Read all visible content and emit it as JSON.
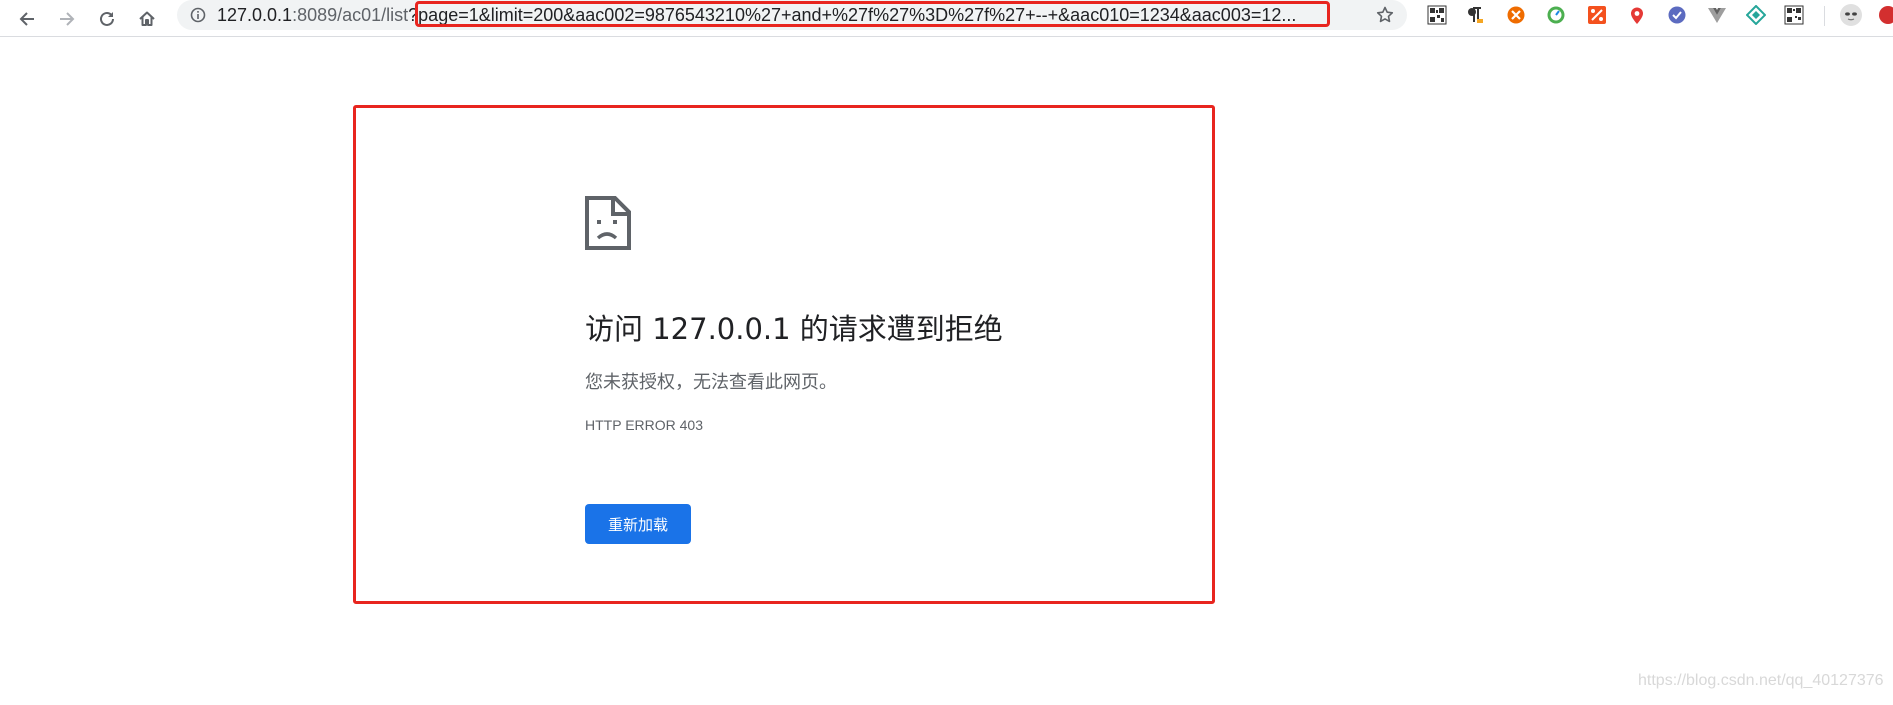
{
  "browser": {
    "url": {
      "host": "127.0.0.1",
      "path": ":8089/ac01/list",
      "query": "?page=1&limit=200&aac002=9876543210%27+and+%27f%27%3D%27f%27+--+&aac010=1234&aac003=12..."
    }
  },
  "icons": {
    "back": "back-arrow-icon",
    "forward": "forward-arrow-icon",
    "reload": "reload-icon",
    "home": "home-icon",
    "info": "info-icon",
    "bookmark": "star-icon",
    "sad_page": "sad-document-icon"
  },
  "error_page": {
    "title": "访问 127.0.0.1 的请求遭到拒绝",
    "description": "您未获授权，无法查看此网页。",
    "error_code": "HTTP ERROR 403",
    "reload_button": "重新加载"
  },
  "colors": {
    "highlight": "#e8251f",
    "button": "#1a73e8"
  },
  "watermark": "https://blog.csdn.net/qq_40127376"
}
